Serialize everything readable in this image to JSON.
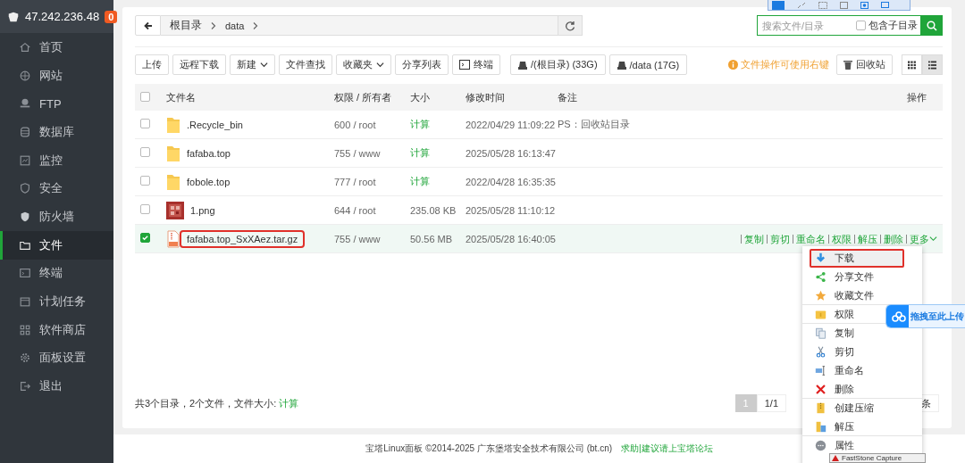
{
  "server": {
    "ip": "47.242.236.48",
    "badge": "0"
  },
  "sidebar": {
    "items": [
      {
        "label": "首页",
        "kind": "home",
        "selected": false
      },
      {
        "label": "网站",
        "kind": "globe",
        "selected": false
      },
      {
        "label": "FTP",
        "kind": "ftp",
        "selected": false
      },
      {
        "label": "数据库",
        "kind": "database",
        "selected": false
      },
      {
        "label": "监控",
        "kind": "monitor",
        "selected": false
      },
      {
        "label": "安全",
        "kind": "shield",
        "selected": false
      },
      {
        "label": "防火墙",
        "kind": "firewall",
        "selected": false
      },
      {
        "label": "文件",
        "kind": "folder",
        "selected": true
      },
      {
        "label": "终端",
        "kind": "terminal",
        "selected": false
      },
      {
        "label": "计划任务",
        "kind": "calendar",
        "selected": false
      },
      {
        "label": "软件商店",
        "kind": "apps",
        "selected": false
      },
      {
        "label": "面板设置",
        "kind": "gear",
        "selected": false
      },
      {
        "label": "退出",
        "kind": "logout",
        "selected": false
      }
    ]
  },
  "breadcrumb": [
    "根目录",
    "data"
  ],
  "search": {
    "placeholder": "搜索文件/目录",
    "subdir_label": "包含子目录",
    "subdir_checked": false
  },
  "toolbar": [
    {
      "label": "上传",
      "kind": "plain"
    },
    {
      "label": "远程下载",
      "kind": "plain"
    },
    {
      "label": "新建",
      "kind": "dropdown"
    },
    {
      "label": "文件查找",
      "kind": "plain"
    },
    {
      "label": "收藏夹",
      "kind": "dropdown"
    },
    {
      "label": "分享列表",
      "kind": "plain"
    },
    {
      "label": "终端",
      "kind": "terminal"
    },
    {
      "label": "/(根目录) (33G)",
      "kind": "disk"
    },
    {
      "label": "/data (17G)",
      "kind": "disk"
    }
  ],
  "hint": "文件操作可使用右键",
  "recycle_button": "回收站",
  "views": [
    {
      "kind": "grid",
      "selected": false
    },
    {
      "kind": "list",
      "selected": true
    }
  ],
  "table": {
    "all_checked": false,
    "columns": [
      "文件名",
      "权限 / 所有者",
      "大小",
      "修改时间",
      "备注",
      "操作"
    ],
    "rows": [
      {
        "kind": "folder",
        "name": ".Recycle_bin",
        "perm": "600 / root",
        "size": "计算",
        "size_is_action": true,
        "mtime": "2022/04/29 11:09:22",
        "remark": "PS：回收站目录",
        "checked": false,
        "selected": false,
        "annotated": false
      },
      {
        "kind": "folder",
        "name": "fafaba.top",
        "perm": "755 / www",
        "size": "计算",
        "size_is_action": true,
        "mtime": "2025/05/28 16:13:47",
        "checked": false,
        "selected": false,
        "annotated": false
      },
      {
        "kind": "folder",
        "name": "fobole.top",
        "perm": "777 / root",
        "size": "计算",
        "size_is_action": true,
        "mtime": "2022/04/28 16:35:35",
        "checked": false,
        "selected": false,
        "annotated": false
      },
      {
        "name": "1.png",
        "perm": "644 / root",
        "size": "235.08 KB",
        "size_is_action": false,
        "mtime": "2025/05/28 11:10:12",
        "checked": false,
        "selected": false,
        "annotated": false
      },
      {
        "kind": "archive",
        "name": "fafaba.top_SxXAez.tar.gz",
        "perm": "755 / www",
        "size": "50.56 MB",
        "size_is_action": false,
        "mtime": "2025/05/28 16:40:05",
        "checked": true,
        "selected": true,
        "annotated": true,
        "actions": [
          "复制",
          "剪切",
          "重命名",
          "权限",
          "解压",
          "删除",
          "更多"
        ]
      }
    ]
  },
  "summary": {
    "text": "共3个目录，2个文件，文件大小:",
    "link": "计算"
  },
  "pager": {
    "current": "1",
    "pages": "1/1",
    "unit": "条"
  },
  "context_menu": {
    "items": [
      {
        "label": "下载",
        "kind": "download",
        "selected": true,
        "annotated": true,
        "divider": false
      },
      {
        "label": "分享文件",
        "kind": "share",
        "selected": false,
        "annotated": false,
        "divider": false
      },
      {
        "label": "收藏文件",
        "kind": "star",
        "selected": false,
        "annotated": false,
        "divider": true
      },
      {
        "label": "权限",
        "kind": "folder",
        "selected": false,
        "annotated": false,
        "divider": true
      },
      {
        "label": "复制",
        "kind": "copy",
        "selected": false,
        "annotated": false,
        "divider": false
      },
      {
        "label": "剪切",
        "kind": "cut",
        "selected": false,
        "annotated": false,
        "divider": false
      },
      {
        "label": "重命名",
        "kind": "rename",
        "selected": false,
        "annotated": false,
        "divider": false
      },
      {
        "label": "删除",
        "kind": "delete",
        "selected": false,
        "annotated": false,
        "divider": true
      },
      {
        "label": "创建压缩",
        "kind": "zip",
        "selected": false,
        "annotated": false,
        "divider": false
      },
      {
        "label": "解压",
        "kind": "unzip",
        "selected": false,
        "annotated": false,
        "divider": true
      },
      {
        "label": "属性",
        "kind": "info",
        "selected": false,
        "annotated": false,
        "divider": false
      }
    ]
  },
  "upload_badge": "拖拽至此上传",
  "capture_window": {
    "title": "FastStone Capture"
  },
  "footer": {
    "text": "宝塔Linux面板 ©2014-2025 广东堡塔安全技术有限公司 (bt.cn)",
    "link": "求助|建议请上宝塔论坛"
  }
}
